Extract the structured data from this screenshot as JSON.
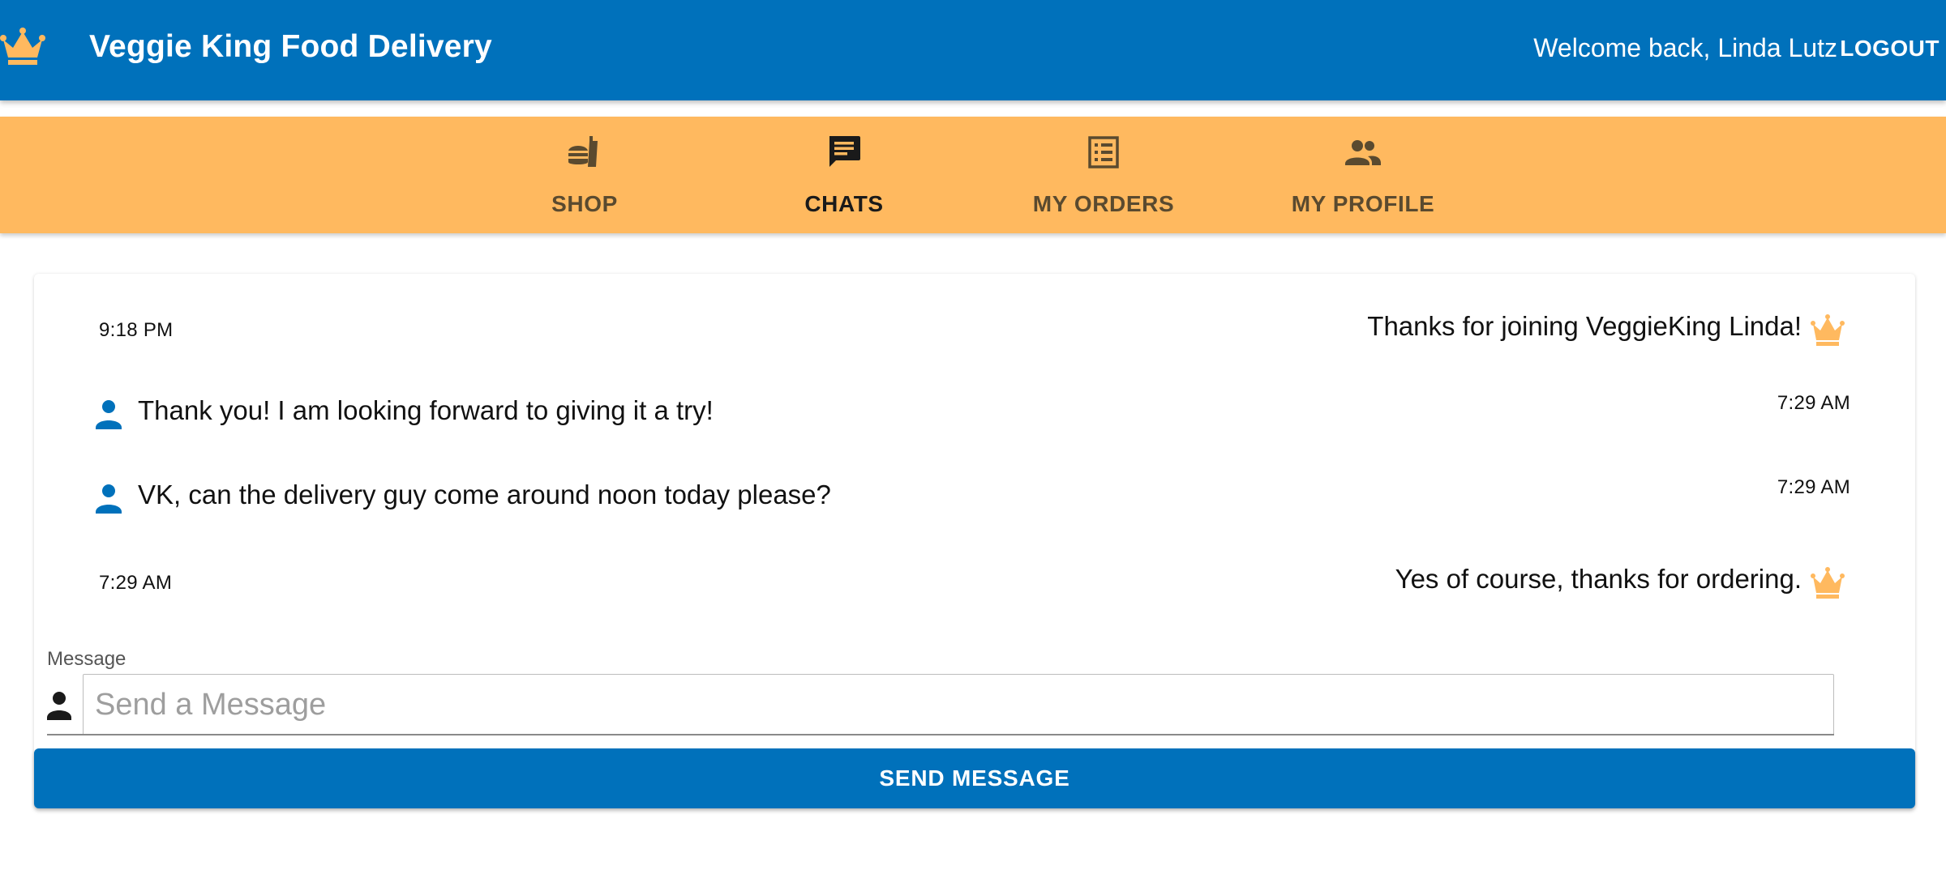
{
  "app": {
    "title": "Veggie King Food Delivery",
    "welcome": "Welcome back, Linda Lutz",
    "logout_label": "LOGOUT",
    "logo_icon": "crown-icon"
  },
  "colors": {
    "primary": "#0071bb",
    "accent": "#ffb95f",
    "nav_text": "#5a4a2f",
    "nav_text_active": "#1a1a1a"
  },
  "nav": {
    "items": [
      {
        "label": "SHOP",
        "icon": "fastfood-icon",
        "active": false
      },
      {
        "label": "CHATS",
        "icon": "chat-icon",
        "active": true
      },
      {
        "label": "MY ORDERS",
        "icon": "list-alt-icon",
        "active": false
      },
      {
        "label": "MY PROFILE",
        "icon": "people-icon",
        "active": false
      }
    ]
  },
  "chat": {
    "messages": [
      {
        "sender": "VeggieKing",
        "text": "Thanks for joining VeggieKing Linda!",
        "time": "9:18 PM",
        "icon": "crown-icon"
      },
      {
        "sender": "Linda Lutz",
        "text": "Thank you! I am looking forward to giving it a try!",
        "time": "7:29 AM",
        "icon": "person-icon"
      },
      {
        "sender": "Linda Lutz",
        "text": "VK, can the delivery guy come around noon today please?",
        "time": "7:29 AM",
        "icon": "person-icon"
      },
      {
        "sender": "VeggieKing",
        "text": "Yes of course, thanks for ordering.",
        "time": "7:29 AM",
        "icon": "crown-icon"
      }
    ]
  },
  "composer": {
    "label": "Message",
    "placeholder": "Send a Message",
    "value": "",
    "icon": "person-icon",
    "send_label": "SEND MESSAGE"
  }
}
